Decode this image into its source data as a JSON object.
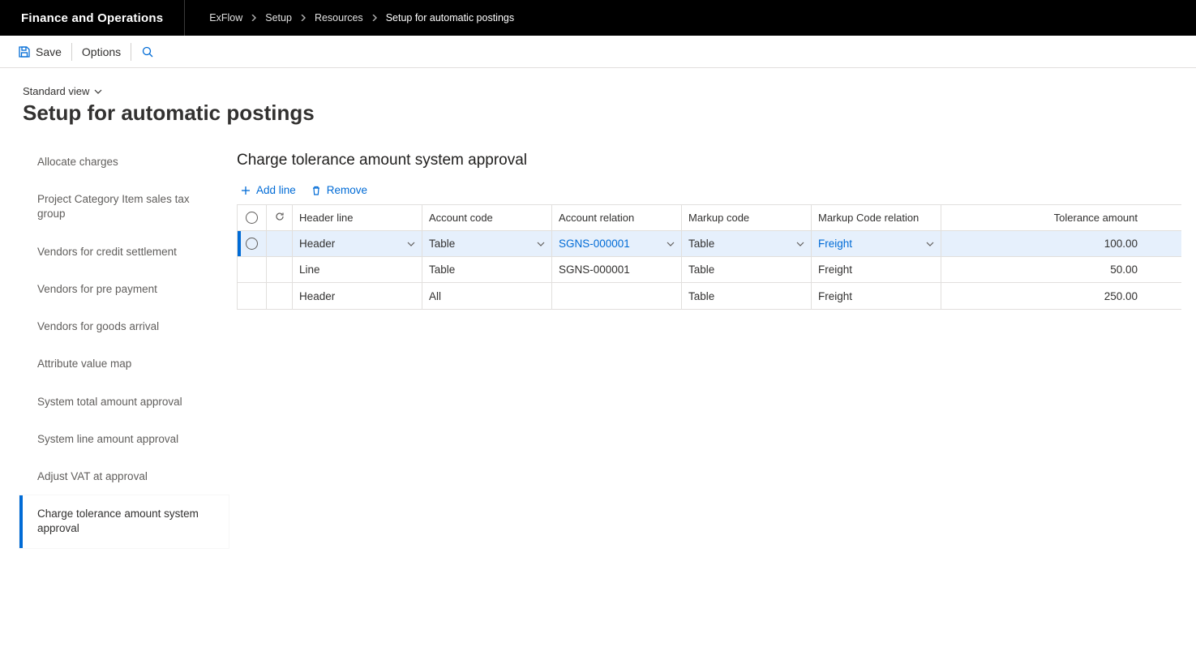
{
  "header": {
    "app_title": "Finance and Operations",
    "breadcrumb": [
      "ExFlow",
      "Setup",
      "Resources",
      "Setup for automatic postings"
    ]
  },
  "actionbar": {
    "save_label": "Save",
    "options_label": "Options"
  },
  "page": {
    "view_selector": "Standard view",
    "title": "Setup for automatic postings"
  },
  "sidebar": {
    "items": [
      {
        "label": "Allocate charges",
        "active": false
      },
      {
        "label": "Project Category Item sales tax group",
        "active": false
      },
      {
        "label": "Vendors for credit settlement",
        "active": false
      },
      {
        "label": "Vendors for pre payment",
        "active": false
      },
      {
        "label": "Vendors for goods arrival",
        "active": false
      },
      {
        "label": "Attribute value map",
        "active": false
      },
      {
        "label": "System total amount approval",
        "active": false
      },
      {
        "label": "System line amount approval",
        "active": false
      },
      {
        "label": "Adjust VAT at approval",
        "active": false
      },
      {
        "label": "Charge tolerance amount system approval",
        "active": true
      }
    ]
  },
  "main": {
    "section_title": "Charge tolerance amount system approval",
    "toolbar": {
      "add_line_label": "Add line",
      "remove_label": "Remove"
    },
    "grid": {
      "columns": {
        "header_line": "Header line",
        "account_code": "Account code",
        "account_relation": "Account relation",
        "markup_code": "Markup code",
        "markup_code_relation": "Markup Code relation",
        "tolerance_amount": "Tolerance amount"
      },
      "rows": [
        {
          "selected": true,
          "header_line": "Header",
          "account_code": "Table",
          "account_relation": "SGNS-000001",
          "markup_code": "Table",
          "markup_code_relation": "Freight",
          "tolerance_amount": "100.00"
        },
        {
          "selected": false,
          "header_line": "Line",
          "account_code": "Table",
          "account_relation": "SGNS-000001",
          "markup_code": "Table",
          "markup_code_relation": "Freight",
          "tolerance_amount": "50.00"
        },
        {
          "selected": false,
          "header_line": "Header",
          "account_code": "All",
          "account_relation": "",
          "markup_code": "Table",
          "markup_code_relation": "Freight",
          "tolerance_amount": "250.00"
        }
      ]
    }
  },
  "colors": {
    "accent": "#006bd6"
  }
}
